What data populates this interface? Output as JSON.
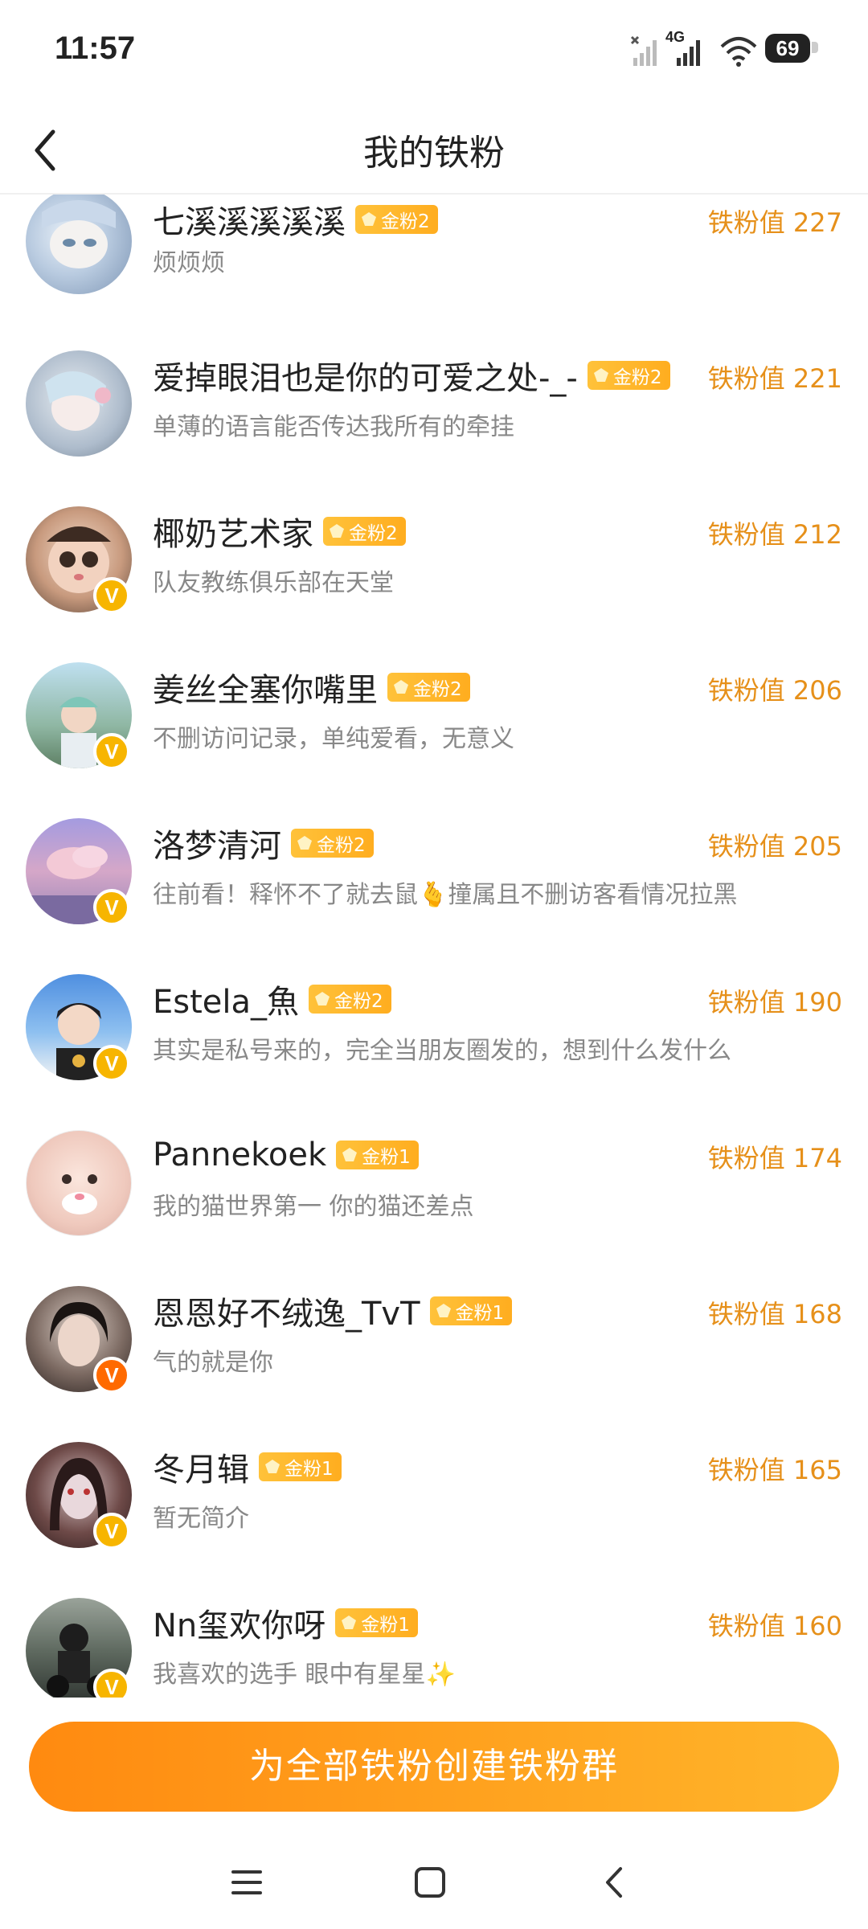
{
  "status": {
    "time": "11:57",
    "network": "4G",
    "battery": "69"
  },
  "header": {
    "title": "我的铁粉"
  },
  "fans": [
    {
      "name": "七溪溪溪溪溪",
      "badge": "金粉2",
      "score": "铁粉值 227",
      "bio": "烦烦烦",
      "verified": false
    },
    {
      "name": "爱掉眼泪也是你的可爱之处-_-",
      "badge": "金粉2",
      "score": "铁粉值 221",
      "bio": "单薄的语言能否传达我所有的牵挂",
      "verified": false
    },
    {
      "name": "椰奶艺术家",
      "badge": "金粉2",
      "score": "铁粉值 212",
      "bio": "队友教练俱乐部在天堂",
      "verified": true
    },
    {
      "name": "姜丝全塞你嘴里",
      "badge": "金粉2",
      "score": "铁粉值 206",
      "bio": "不删访问记录，单纯爱看，无意义",
      "verified": true
    },
    {
      "name": "洛梦清河",
      "badge": "金粉2",
      "score": "铁粉值 205",
      "bio": "往前看！释怀不了就去鼠🫰撞属且不删访客看情况拉黑",
      "verified": true
    },
    {
      "name": "Estela_魚",
      "badge": "金粉2",
      "score": "铁粉值 190",
      "bio": "其实是私号来的，完全当朋友圈发的，想到什么发什么",
      "verified": true
    },
    {
      "name": "Pannekoek",
      "badge": "金粉1",
      "score": "铁粉值 174",
      "bio": "我的猫世界第一 你的猫还差点",
      "verified": false
    },
    {
      "name": "恩恩好不绒逸_TvT",
      "badge": "金粉1",
      "score": "铁粉值 168",
      "bio": "气的就是你",
      "verified": true
    },
    {
      "name": "冬月辑",
      "badge": "金粉1",
      "score": "铁粉值 165",
      "bio": "暂无简介",
      "verified": true
    },
    {
      "name": "Nn玺欢你呀",
      "badge": "金粉1",
      "score": "铁粉值 160",
      "bio": "我喜欢的选手 眼中有星星✨",
      "verified": true
    }
  ],
  "cta": {
    "label": "为全部铁粉创建铁粉群"
  },
  "colors": {
    "accent": "#ff8a10",
    "score": "#e6901a",
    "badge": "#ffb52a",
    "verified": "#f7b500"
  },
  "icons": {
    "back": "chevron-left-icon",
    "gem": "gem-icon",
    "menu": "menu-icon",
    "home": "home-square-icon",
    "nav_back": "nav-back-icon"
  }
}
